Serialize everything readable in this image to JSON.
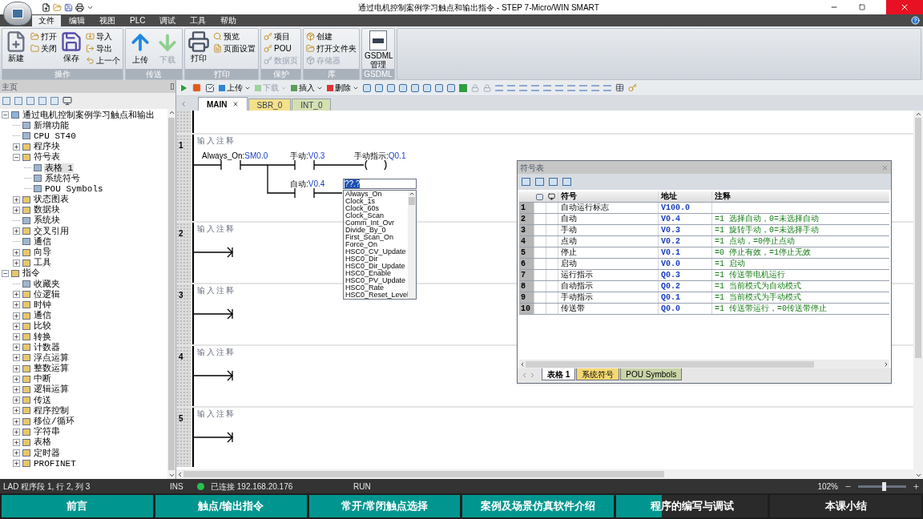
{
  "window": {
    "title": "通过电机控制案例学习触点和输出指令 - STEP 7-Micro/WIN SMART"
  },
  "ribbon": {
    "tabs": [
      {
        "label": "文件",
        "selected": true
      },
      {
        "label": "编辑",
        "selected": false
      },
      {
        "label": "视图",
        "selected": false
      },
      {
        "label": "PLC",
        "selected": false
      },
      {
        "label": "调试",
        "selected": false
      },
      {
        "label": "工具",
        "selected": false
      },
      {
        "label": "帮助",
        "selected": false
      }
    ],
    "groups": [
      {
        "title": "操作",
        "items": [
          {
            "label": "新建",
            "kind": "large",
            "disabled": false
          },
          {
            "label": "打开",
            "kind": "small",
            "disabled": false
          },
          {
            "label": "关闭",
            "kind": "small",
            "disabled": false
          },
          {
            "label": "保存",
            "kind": "large",
            "disabled": false
          },
          {
            "label": "导入",
            "kind": "small",
            "disabled": false
          },
          {
            "label": "导出",
            "kind": "small",
            "disabled": false
          },
          {
            "label": "上一个",
            "kind": "small",
            "disabled": false
          }
        ]
      },
      {
        "title": "传送",
        "items": [
          {
            "label": "上传",
            "kind": "large",
            "disabled": false
          },
          {
            "label": "下载",
            "kind": "large",
            "disabled": true
          }
        ]
      },
      {
        "title": "打印",
        "items": [
          {
            "label": "打印",
            "kind": "large",
            "disabled": false
          },
          {
            "label": "预览",
            "kind": "small",
            "disabled": false
          },
          {
            "label": "页面设置",
            "kind": "small",
            "disabled": false
          }
        ]
      },
      {
        "title": "保护",
        "items": [
          {
            "label": "项目",
            "kind": "small",
            "disabled": false
          },
          {
            "label": "POU",
            "kind": "small",
            "disabled": false
          },
          {
            "label": "数据页",
            "kind": "small",
            "disabled": true
          }
        ]
      },
      {
        "title": "库",
        "items": [
          {
            "label": "创建",
            "kind": "small",
            "disabled": false
          },
          {
            "label": "打开文件夹",
            "kind": "small",
            "disabled": false
          },
          {
            "label": "存储器",
            "kind": "small",
            "disabled": true
          }
        ]
      },
      {
        "title": "GSDML",
        "items": [
          {
            "label": "GSDML 管理",
            "kind": "large",
            "disabled": false
          }
        ]
      }
    ]
  },
  "sidebar": {
    "title": "主页",
    "tree": [
      {
        "label": "通过电机控制案例学习触点和输出",
        "kind": "project",
        "expanded": true,
        "selected": false,
        "children": [
          {
            "label": "新增功能",
            "kind": "leaf",
            "selected": false
          },
          {
            "label": "CPU ST40",
            "kind": "leaf",
            "selected": false
          },
          {
            "label": "程序块",
            "kind": "folder",
            "expanded": false,
            "selected": false
          },
          {
            "label": "符号表",
            "kind": "folder",
            "expanded": true,
            "selected": false,
            "children": [
              {
                "label": "表格 1",
                "kind": "leaf",
                "selected": true
              },
              {
                "label": "系统符号",
                "kind": "leaf",
                "selected": false
              },
              {
                "label": "POU Symbols",
                "kind": "leaf",
                "selected": false
              }
            ]
          },
          {
            "label": "状态图表",
            "kind": "folder",
            "expanded": false,
            "selected": false
          },
          {
            "label": "数据块",
            "kind": "folder",
            "expanded": false,
            "selected": false
          },
          {
            "label": "系统块",
            "kind": "leaf",
            "selected": false
          },
          {
            "label": "交叉引用",
            "kind": "folder",
            "expanded": false,
            "selected": false
          },
          {
            "label": "通信",
            "kind": "leaf",
            "selected": false
          },
          {
            "label": "向导",
            "kind": "folder",
            "expanded": false,
            "selected": false
          },
          {
            "label": "工具",
            "kind": "folder",
            "expanded": false,
            "selected": false
          }
        ]
      },
      {
        "label": "指令",
        "kind": "folder",
        "expanded": true,
        "selected": false,
        "children": [
          {
            "label": "收藏夹",
            "kind": "leaf",
            "selected": false
          },
          {
            "label": "位逻辑",
            "kind": "folder",
            "expanded": false,
            "selected": false
          },
          {
            "label": "时钟",
            "kind": "folder",
            "expanded": false,
            "selected": false
          },
          {
            "label": "通信",
            "kind": "folder",
            "expanded": false,
            "selected": false
          },
          {
            "label": "比较",
            "kind": "folder",
            "expanded": false,
            "selected": false
          },
          {
            "label": "转换",
            "kind": "folder",
            "expanded": false,
            "selected": false
          },
          {
            "label": "计数器",
            "kind": "folder",
            "expanded": false,
            "selected": false
          },
          {
            "label": "浮点运算",
            "kind": "folder",
            "expanded": false,
            "selected": false
          },
          {
            "label": "整数运算",
            "kind": "folder",
            "expanded": false,
            "selected": false
          },
          {
            "label": "中断",
            "kind": "folder",
            "expanded": false,
            "selected": false
          },
          {
            "label": "逻辑运算",
            "kind": "folder",
            "expanded": false,
            "selected": false
          },
          {
            "label": "传送",
            "kind": "folder",
            "expanded": false,
            "selected": false
          },
          {
            "label": "程序控制",
            "kind": "folder",
            "expanded": false,
            "selected": false
          },
          {
            "label": "移位/循环",
            "kind": "folder",
            "expanded": false,
            "selected": false
          },
          {
            "label": "字符串",
            "kind": "folder",
            "expanded": false,
            "selected": false
          },
          {
            "label": "表格",
            "kind": "folder",
            "expanded": false,
            "selected": false
          },
          {
            "label": "定时器",
            "kind": "folder",
            "expanded": false,
            "selected": false
          },
          {
            "label": "PROFINET",
            "kind": "folder",
            "expanded": false,
            "selected": false
          }
        ]
      }
    ]
  },
  "editor": {
    "toolbar": [
      {
        "label": "上传",
        "disabled": false
      },
      {
        "label": "下载",
        "disabled": true
      },
      {
        "label": "插入",
        "disabled": false
      },
      {
        "label": "删除",
        "disabled": false
      }
    ],
    "tabs": [
      {
        "label": "MAIN",
        "selected": true,
        "color": "#ffffff"
      },
      {
        "label": "SBR_0",
        "selected": false,
        "color": "#f7e08a"
      },
      {
        "label": "INT_0",
        "selected": false,
        "color": "#d4e0b0"
      }
    ],
    "networks": [
      {
        "number": "1",
        "comment": "输入注释"
      },
      {
        "number": "2",
        "comment": "输入注释"
      },
      {
        "number": "3",
        "comment": "输入注释"
      },
      {
        "number": "4",
        "comment": "输入注释"
      },
      {
        "number": "5",
        "comment": "输入注释"
      }
    ],
    "rung": {
      "contacts": [
        {
          "symbol": "Always_On:",
          "address": "SM0.0"
        },
        {
          "symbol": "手动:",
          "address": "V0.3"
        },
        {
          "symbol": "自动:",
          "address": "V0.4"
        }
      ],
      "coil": {
        "symbol": "手动指示:",
        "address": "Q0.1"
      },
      "entry": {
        "value": "??.?"
      },
      "suggestions": [
        "Always_On",
        "Clock_1s",
        "Clock_60s",
        "Clock_Scan",
        "Comm_Int_Ovr",
        "Divide_By_0",
        "First_Scan_On",
        "Force_On",
        "HSC0_CV_Update",
        "HSC0_Dir",
        "HSC0_Dir_Update",
        "HSC0_Enable",
        "HSC0_PV_Update",
        "HSC0_Rate",
        "HSC0_Reset_Level"
      ]
    }
  },
  "symbol_table": {
    "title": "符号表",
    "columns": [
      "符号",
      "地址",
      "注释"
    ],
    "rows": [
      {
        "number": "1",
        "symbol": "自动运行标志",
        "address": "V100.0"
      },
      {
        "number": "2",
        "symbol": "自动",
        "address": "V0.4",
        "comment": "=1 选择自动，0=未选择自动"
      },
      {
        "number": "3",
        "symbol": "手动",
        "address": "V0.3",
        "comment": "=1 旋转手动，0=未选择手动"
      },
      {
        "number": "4",
        "symbol": "点动",
        "address": "V0.2",
        "comment": "=1 点动，=0停止点动"
      },
      {
        "number": "5",
        "symbol": "停止",
        "address": "V0.1",
        "comment": "=0 停止有效，=1停止无效"
      },
      {
        "number": "6",
        "symbol": "启动",
        "address": "V0.0",
        "comment": "=1 启动"
      },
      {
        "number": "7",
        "symbol": "运行指示",
        "address": "Q0.3",
        "comment": "=1 传送带电机运行"
      },
      {
        "number": "8",
        "symbol": "自动指示",
        "address": "Q0.2",
        "comment": "=1 当前模式为自动模式"
      },
      {
        "number": "9",
        "symbol": "手动指示",
        "address": "Q0.1",
        "comment": "=1 当前模式为手动模式"
      },
      {
        "number": "10",
        "symbol": "传送带",
        "address": "Q0.0",
        "comment": "=1 传送带运行，=0传送带停止"
      }
    ],
    "sheets": [
      {
        "label": "表格 1",
        "selected": true,
        "color": "#ffffff"
      },
      {
        "label": "系统符号",
        "selected": false,
        "color": "#f5d873"
      },
      {
        "label": "POU Symbols",
        "selected": false,
        "color": "#c9d4a8"
      }
    ]
  },
  "status_bar": {
    "position": "LAD 程序段 1, 行 2, 列 3",
    "mode": "INS",
    "connection": "已连接 192.168.20.176",
    "connected": true,
    "state": "RUN",
    "zoom": "102%",
    "zoom_slider": {
      "level": 0.55
    }
  },
  "chapters": [
    {
      "label": "前言",
      "level": 1
    },
    {
      "label": "触点/输出指令",
      "level": 1
    },
    {
      "label": "常开/常闭触点选择",
      "level": 1
    },
    {
      "label": "案例及场景仿真软件介绍",
      "level": 1
    },
    {
      "label": "程序的编写与调试",
      "level": 0.3
    },
    {
      "label": "本课小结"
    }
  ]
}
